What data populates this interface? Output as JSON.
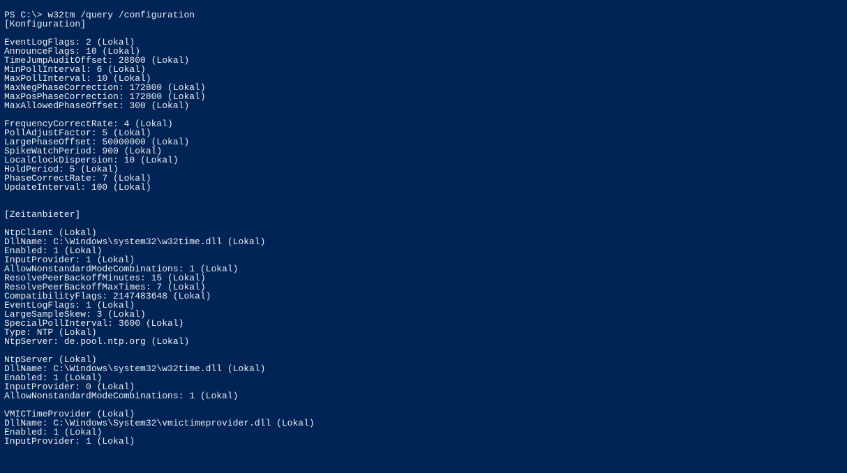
{
  "prompt": "PS C:\\>",
  "command": "w32tm /query /configuration",
  "output_lines": [
    "[Konfiguration]",
    "",
    "EventLogFlags: 2 (Lokal)",
    "AnnounceFlags: 10 (Lokal)",
    "TimeJumpAuditOffset: 28800 (Lokal)",
    "MinPollInterval: 6 (Lokal)",
    "MaxPollInterval: 10 (Lokal)",
    "MaxNegPhaseCorrection: 172800 (Lokal)",
    "MaxPosPhaseCorrection: 172800 (Lokal)",
    "MaxAllowedPhaseOffset: 300 (Lokal)",
    "",
    "FrequencyCorrectRate: 4 (Lokal)",
    "PollAdjustFactor: 5 (Lokal)",
    "LargePhaseOffset: 50000000 (Lokal)",
    "SpikeWatchPeriod: 900 (Lokal)",
    "LocalClockDispersion: 10 (Lokal)",
    "HoldPeriod: 5 (Lokal)",
    "PhaseCorrectRate: 7 (Lokal)",
    "UpdateInterval: 100 (Lokal)",
    "",
    "",
    "[Zeitanbieter]",
    "",
    "NtpClient (Lokal)",
    "DllName: C:\\Windows\\system32\\w32time.dll (Lokal)",
    "Enabled: 1 (Lokal)",
    "InputProvider: 1 (Lokal)",
    "AllowNonstandardModeCombinations: 1 (Lokal)",
    "ResolvePeerBackoffMinutes: 15 (Lokal)",
    "ResolvePeerBackoffMaxTimes: 7 (Lokal)",
    "CompatibilityFlags: 2147483648 (Lokal)",
    "EventLogFlags: 1 (Lokal)",
    "LargeSampleSkew: 3 (Lokal)",
    "SpecialPollInterval: 3600 (Lokal)",
    "Type: NTP (Lokal)",
    "NtpServer: de.pool.ntp.org (Lokal)",
    "",
    "NtpServer (Lokal)",
    "DllName: C:\\Windows\\system32\\w32time.dll (Lokal)",
    "Enabled: 1 (Lokal)",
    "InputProvider: 0 (Lokal)",
    "AllowNonstandardModeCombinations: 1 (Lokal)",
    "",
    "VMICTimeProvider (Lokal)",
    "DllName: C:\\Windows\\System32\\vmictimeprovider.dll (Lokal)",
    "Enabled: 1 (Lokal)",
    "InputProvider: 1 (Lokal)"
  ]
}
